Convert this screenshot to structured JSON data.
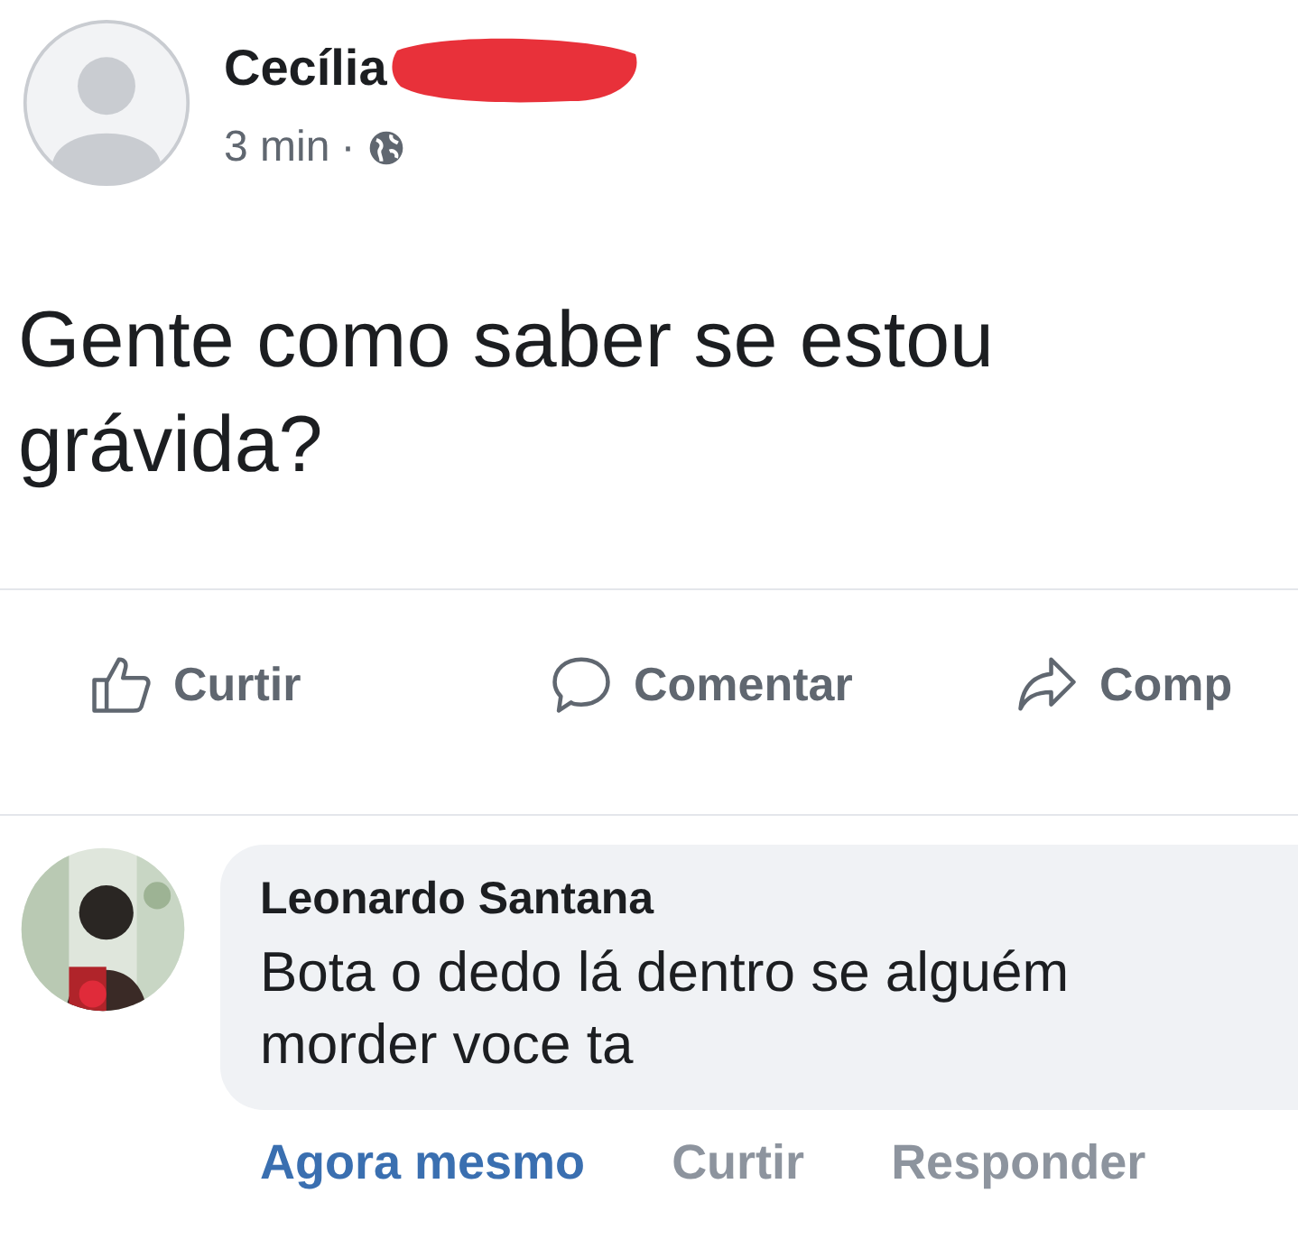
{
  "post": {
    "author": "Cecília",
    "time": "3 min",
    "separator": "·",
    "text": "Gente como saber se estou grávida?"
  },
  "actions": [
    {
      "kind": "like",
      "label": "Curtir"
    },
    {
      "kind": "comment",
      "label": "Comentar"
    },
    {
      "kind": "share",
      "label": "Comp"
    }
  ],
  "comment": {
    "author": "Leonardo Santana",
    "text": "Bota o dedo lá dentro se alguém morder voce ta",
    "time": "Agora mesmo",
    "actions": [
      "Curtir",
      "Responder"
    ]
  }
}
